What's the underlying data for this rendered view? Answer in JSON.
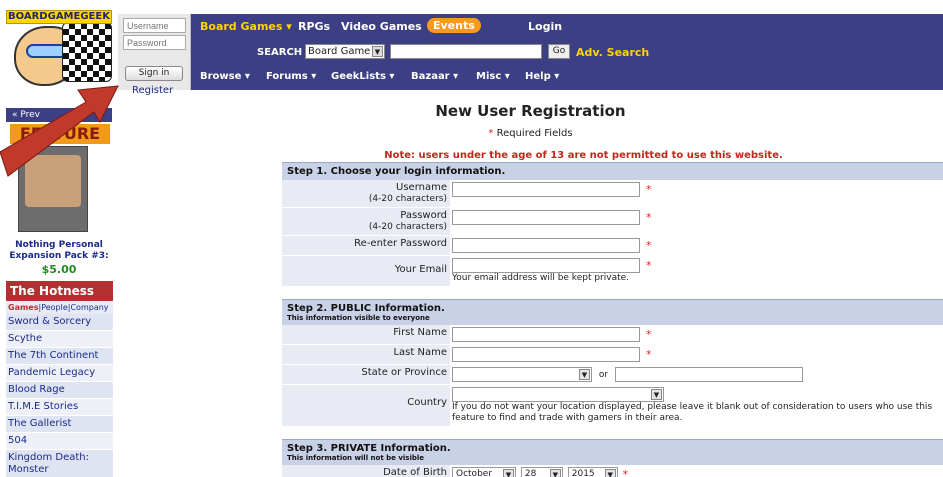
{
  "logo": {
    "text": "BOARDGAMEGEEK"
  },
  "login": {
    "username_placeholder": "Username",
    "password_placeholder": "Password",
    "signin_label": "Sign in",
    "register_label": "Register"
  },
  "topnav": {
    "items": [
      "Board Games ▾",
      "RPGs",
      "Video Games"
    ],
    "events": "Events",
    "login": "Login"
  },
  "search": {
    "label": "SEARCH",
    "select_value": "Board Game",
    "go_label": "Go",
    "adv_label": "Adv. Search"
  },
  "subnav": [
    "Browse ▾",
    "Forums ▾",
    "GeekLists ▾",
    "Bazaar ▾",
    "Misc ▾",
    "Help ▾"
  ],
  "sidebar": {
    "prev_label": "« Prev",
    "ad_title": "FEATURE",
    "ad_caption": "Nothing Personal Expansion Pack #3:",
    "ad_price": "$5.00",
    "hotness_title": "The Hotness",
    "hotness_tab_active": "Games",
    "hotness_tabs": "|People|Company",
    "hotness_items": [
      "Sword & Sorcery",
      "Scythe",
      "The 7th Continent",
      "Pandemic Legacy",
      "Blood Rage",
      "T.I.M.E Stories",
      "The Gallerist",
      "504",
      "Kingdom Death: Monster"
    ]
  },
  "page": {
    "title": "New User Registration",
    "required_note": "Required Fields",
    "required_star": "*",
    "warning": "Note: users under the age of 13 are not permitted to use this website."
  },
  "step1": {
    "title": "Step 1. Choose your login information.",
    "username_label": "Username",
    "username_hint": "(4-20 characters)",
    "password_label": "Password",
    "password_hint": "(4-20 characters)",
    "reenter_label": "Re-enter Password",
    "email_label": "Your Email",
    "email_note": "Your email address will be kept private."
  },
  "step2": {
    "title": "Step 2. PUBLIC Information.",
    "subtitle": "This information visible to everyone",
    "first_name_label": "First Name",
    "last_name_label": "Last Name",
    "state_label": "State or Province",
    "or_text": "or",
    "country_label": "Country",
    "country_note": "If you do not want your location displayed, please leave it blank out of consideration to users who use this feature to find and trade with gamers in their area."
  },
  "step3": {
    "title": "Step 3. PRIVATE Information.",
    "subtitle": "This information will not be visible",
    "dob_label": "Date of Birth",
    "dob_month": "October",
    "dob_day": "28",
    "dob_year": "2015"
  }
}
